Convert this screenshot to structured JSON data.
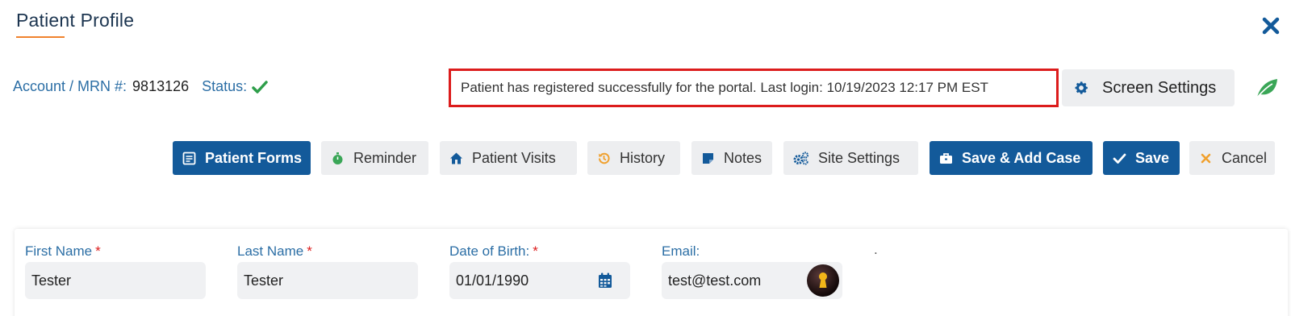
{
  "header": {
    "title": "Patient Profile",
    "close_icon": "close-icon",
    "accent_color": "#f0822d"
  },
  "account": {
    "label": "Account / MRN #:",
    "value": "9813126",
    "status_label": "Status:",
    "status_icon": "check-icon",
    "status_color": "#2e9e4a"
  },
  "portal_message": {
    "text": "Patient has registered successfully for the portal. Last login: 10/19/2023 12:17 PM EST",
    "border_color": "#dc1c1c"
  },
  "screen_settings": {
    "label": "Screen Settings",
    "icon": "gear-icon"
  },
  "leaf_icon": "leaf-icon",
  "toolbar": {
    "buttons": [
      {
        "label": "Patient Forms",
        "icon": "form-icon",
        "style": "primary"
      },
      {
        "label": "Reminder",
        "icon": "stopwatch-icon",
        "style": "secondary"
      },
      {
        "label": "Patient Visits",
        "icon": "house-icon",
        "style": "secondary"
      },
      {
        "label": "History",
        "icon": "history-icon",
        "style": "secondary"
      },
      {
        "label": "Notes",
        "icon": "note-icon",
        "style": "secondary"
      },
      {
        "label": "Site Settings",
        "icon": "cogs-icon",
        "style": "secondary"
      },
      {
        "label": "Save & Add Case",
        "icon": "briefcase-icon",
        "style": "primary"
      },
      {
        "label": "Save",
        "icon": "check-icon",
        "style": "primary"
      },
      {
        "label": "Cancel",
        "icon": "x-icon",
        "style": "secondary"
      }
    ],
    "primary_color": "#135a9a"
  },
  "form": {
    "first_name": {
      "label": "First Name",
      "required": "*",
      "value": "Tester"
    },
    "last_name": {
      "label": "Last Name",
      "required": "*",
      "value": "Tester"
    },
    "dob": {
      "label": "Date of Birth:",
      "required": "*",
      "value": "01/01/1990",
      "icon": "calendar-icon"
    },
    "email": {
      "label": "Email:",
      "value": "test@test.com",
      "icon": "keyhole-icon"
    },
    "stray_mark": "."
  }
}
